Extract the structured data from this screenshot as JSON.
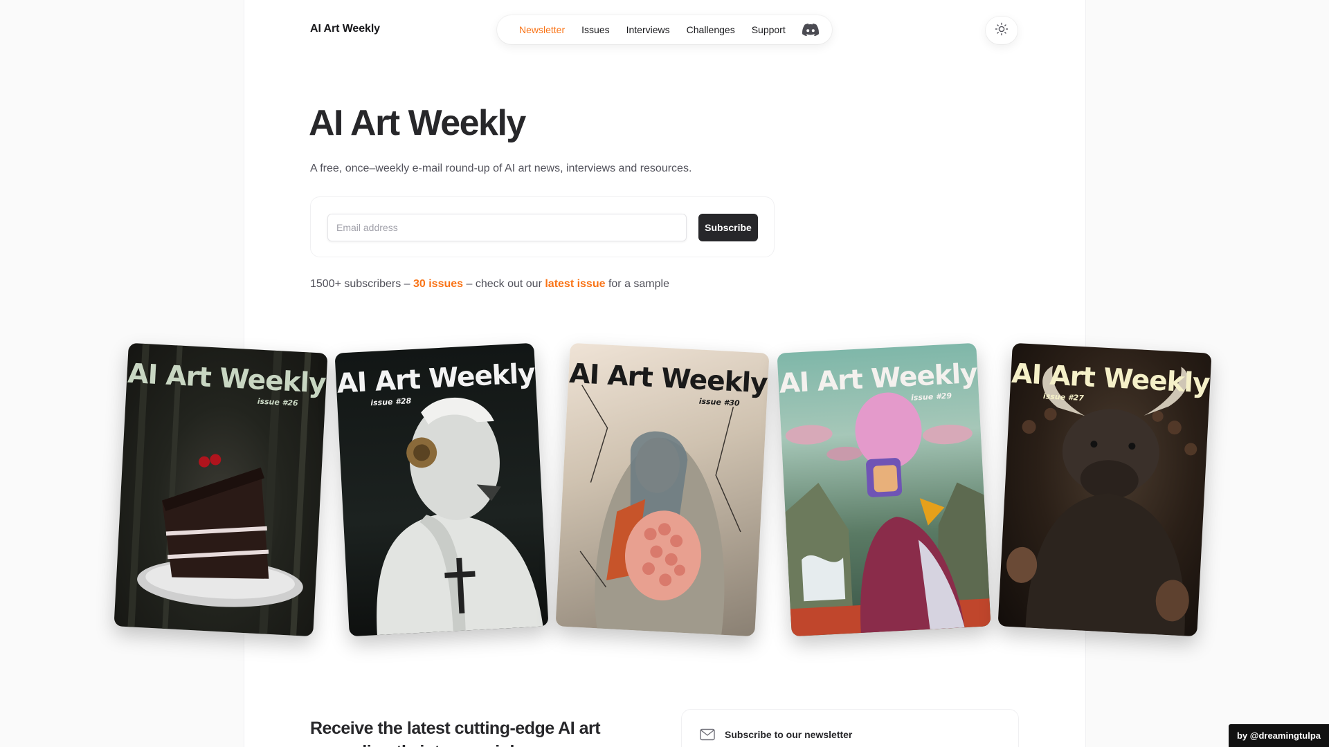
{
  "brand": "AI Art Weekly",
  "nav": {
    "items": [
      {
        "label": "Newsletter",
        "active": true
      },
      {
        "label": "Issues"
      },
      {
        "label": "Interviews"
      },
      {
        "label": "Challenges"
      },
      {
        "label": "Support"
      }
    ],
    "discord_icon": "discord-icon",
    "theme_icon": "sun-icon"
  },
  "hero": {
    "title": "AI Art Weekly",
    "description": "A free, once–weekly e-mail round-up of AI art news, interviews and resources."
  },
  "subscribe": {
    "placeholder": "Email address",
    "value": "",
    "button": "Subscribe"
  },
  "stats": {
    "prefix": "1500+ subscribers – ",
    "issues_link": "30 issues",
    "middle": " – check out our ",
    "latest_link": "latest issue",
    "suffix": " for a sample"
  },
  "covers": [
    {
      "masthead": "AI Art Weekly",
      "issue": "issue #26"
    },
    {
      "masthead": "AI Art Weekly",
      "issue": "issue #28"
    },
    {
      "masthead": "AI Art Weekly",
      "issue": "issue #30"
    },
    {
      "masthead": "AI Art Weekly",
      "issue": "issue #29"
    },
    {
      "masthead": "AI Art Weekly",
      "issue": "issue #27"
    }
  ],
  "section": {
    "heading": "Receive the latest cutting-edge AI art news directly into your inbox"
  },
  "newsletter_card": {
    "icon": "mail-icon",
    "title": "Subscribe to our newsletter"
  },
  "credit": "by @dreamingtulpa",
  "colors": {
    "accent": "#f97316",
    "dark": "#27272a"
  }
}
